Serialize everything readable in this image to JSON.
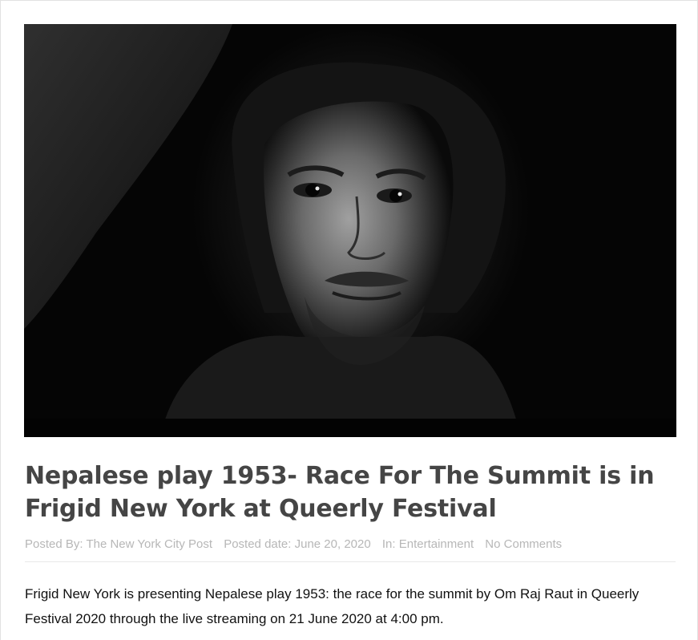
{
  "article": {
    "title": "Nepalese play 1953- Race For The Summit is in Frigid New York at Queerly Festival",
    "meta": {
      "posted_by_label": "Posted By:",
      "author": "The New York City Post",
      "date_label": "Posted date:",
      "date": "June 20, 2020",
      "category_label": "In:",
      "category": "Entertainment",
      "comments": "No Comments"
    },
    "excerpt": "Frigid New York is presenting Nepalese play 1953: the race for the summit by Om Raj Raut in Queerly Festival 2020 through the live streaming on 21 June 2020 at 4:00 pm."
  },
  "image": {
    "kind": "black-and-white photo",
    "colors": {
      "background": "#050505",
      "skin_highlight": "#9a9a9a"
    }
  }
}
